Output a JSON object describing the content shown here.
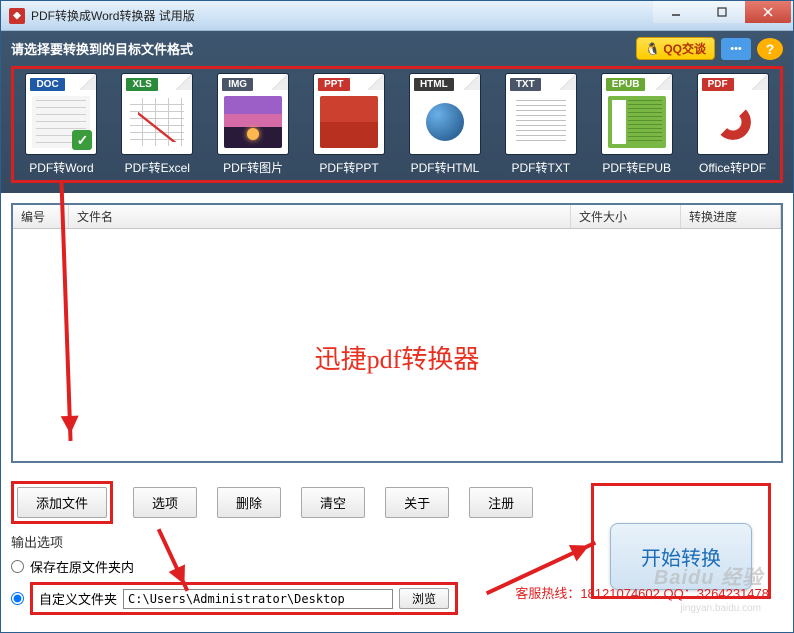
{
  "window": {
    "title": "PDF转换成Word转换器 试用版"
  },
  "toolbar": {
    "prompt": "请选择要转换到的目标文件格式",
    "qq_label": "QQ交谈",
    "chat_dots": "•••",
    "help_label": "?"
  },
  "formats": [
    {
      "badge": "DOC",
      "label": "PDF转Word",
      "cls": "doc"
    },
    {
      "badge": "XLS",
      "label": "PDF转Excel",
      "cls": "xls"
    },
    {
      "badge": "IMG",
      "label": "PDF转图片",
      "cls": "img"
    },
    {
      "badge": "PPT",
      "label": "PDF转PPT",
      "cls": "ppt"
    },
    {
      "badge": "HTML",
      "label": "PDF转HTML",
      "cls": "html"
    },
    {
      "badge": "TXT",
      "label": "PDF转TXT",
      "cls": "txt"
    },
    {
      "badge": "EPUB",
      "label": "PDF转EPUB",
      "cls": "epub"
    },
    {
      "badge": "PDF",
      "label": "Office转PDF",
      "cls": "pdf"
    }
  ],
  "list": {
    "col_num": "编号",
    "col_name": "文件名",
    "col_size": "文件大小",
    "col_progress": "转换进度",
    "center_text": "迅捷pdf转换器"
  },
  "buttons": {
    "add_file": "添加文件",
    "options": "选项",
    "delete": "删除",
    "clear": "清空",
    "about": "关于",
    "register": "注册",
    "start": "开始转换",
    "browse": "浏览"
  },
  "output": {
    "section_label": "输出选项",
    "save_original": "保存在原文件夹内",
    "custom_folder": "自定义文件夹",
    "path_value": "C:\\Users\\Administrator\\Desktop"
  },
  "hotline": "客服热线：18121074602 QQ：3264231478",
  "watermark": "Baidu 经验",
  "watermark_sub": "jingyan.baidu.com"
}
